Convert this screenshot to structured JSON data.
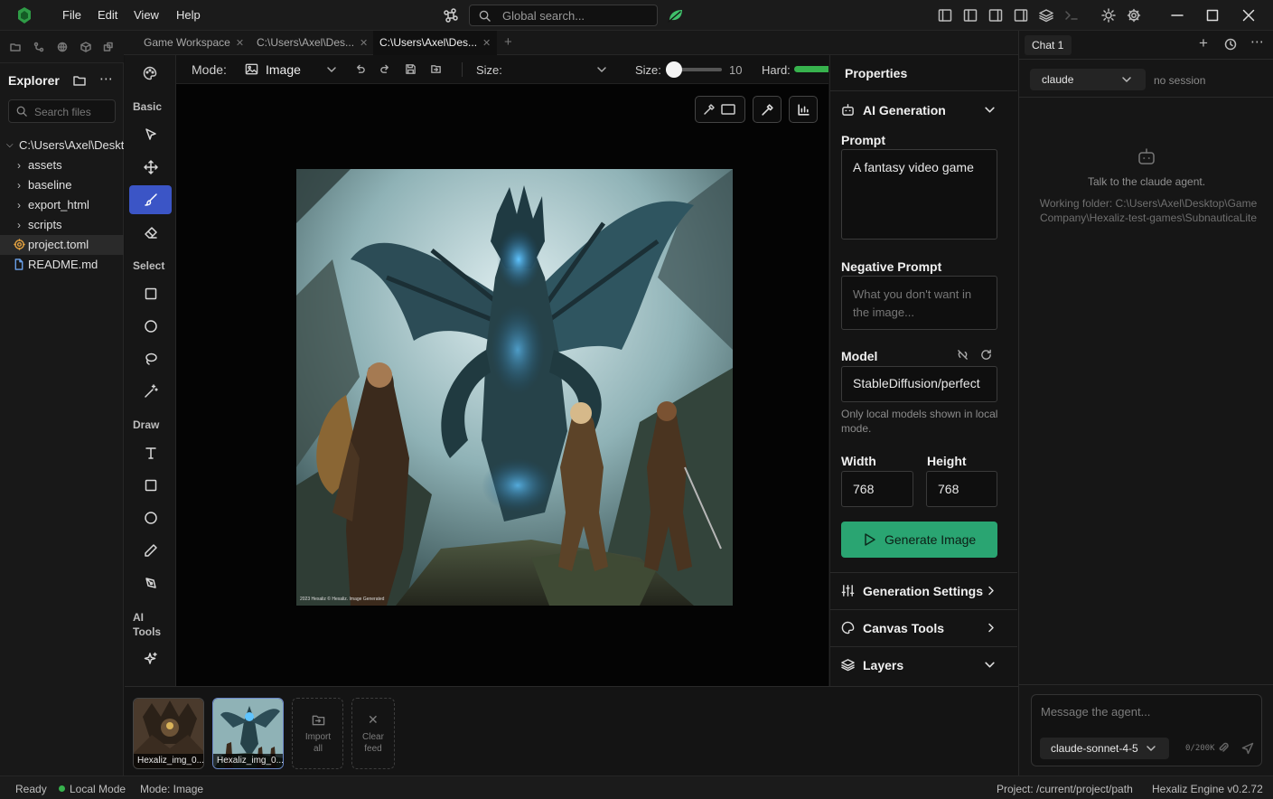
{
  "menu": [
    "File",
    "Edit",
    "View",
    "Help"
  ],
  "search": {
    "placeholder": "Global search..."
  },
  "tabs": [
    {
      "label": "Game Workspace"
    },
    {
      "label": "C:\\Users\\Axel\\Des..."
    },
    {
      "label": "C:\\Users\\Axel\\Des..."
    }
  ],
  "explorer": {
    "title": "Explorer",
    "search_placeholder": "Search files",
    "root": "C:\\Users\\Axel\\Desktop",
    "items": [
      {
        "label": "assets",
        "type": "folder"
      },
      {
        "label": "baseline",
        "type": "folder"
      },
      {
        "label": "export_html",
        "type": "folder"
      },
      {
        "label": "scripts",
        "type": "folder"
      },
      {
        "label": "project.toml",
        "type": "file"
      },
      {
        "label": "README.md",
        "type": "file"
      }
    ]
  },
  "palette": {
    "sections": {
      "basic": "Basic",
      "select": "Select",
      "draw": "Draw",
      "ai_tools": "AI Tools"
    }
  },
  "toolbar": {
    "mode_label": "Mode:",
    "mode_value": "Image",
    "size_label": "Size:",
    "size_label2": "Size:",
    "size_value": "10",
    "hard_label": "Hard:"
  },
  "canvas": {
    "watermark": "2023 Hexaliz © Hexaliz. Image Generated"
  },
  "properties": {
    "title": "Properties",
    "ai_generation": "AI Generation",
    "prompt_label": "Prompt",
    "prompt_value": "A fantasy video game",
    "negative_label": "Negative Prompt",
    "negative_placeholder": "What you don't want in the image...",
    "model_label": "Model",
    "model_value": "StableDiffusion/perfect",
    "model_hint": "Only local models shown in local mode.",
    "width_label": "Width",
    "width_value": "768",
    "height_label": "Height",
    "height_value": "768",
    "generate_button": "Generate Image",
    "generation_settings": "Generation Settings",
    "canvas_tools": "Canvas Tools",
    "layers": "Layers"
  },
  "chat": {
    "tab": "Chat 1",
    "agent_select": "claude",
    "session": "no session",
    "talk_text": "Talk to the claude agent.",
    "working_folder": "Working folder: C:\\Users\\Axel\\Desktop\\Game Company\\Hexaliz-test-games\\SubnauticaLite",
    "message_placeholder": "Message the agent...",
    "model_select": "claude-sonnet-4-5",
    "counter": "0/200K"
  },
  "feed": {
    "items": [
      {
        "label": "Hexaliz_img_0..."
      },
      {
        "label": "Hexaliz_img_0..."
      }
    ],
    "import_all": "Import all",
    "clear_feed": "Clear feed"
  },
  "status": {
    "ready": "Ready",
    "local_mode": "Local Mode",
    "mode": "Mode: Image",
    "project": "Project: /current/project/path",
    "engine": "Hexaliz Engine v0.2.72"
  },
  "colors": {
    "accent": "#3b55c6",
    "generate": "#2aa572",
    "status_ok": "#37b24d",
    "logo": "#2e9b46"
  }
}
